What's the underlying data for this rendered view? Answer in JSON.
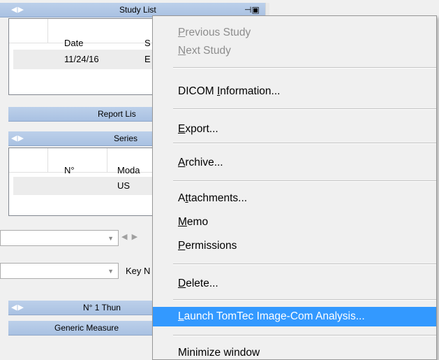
{
  "study_list": {
    "title": "Study List",
    "columns": [
      "Date",
      "S"
    ],
    "rows": [
      [
        "11/24/16",
        "E"
      ]
    ]
  },
  "report_list": {
    "title": "Report Lis"
  },
  "series": {
    "title": "Series",
    "columns": [
      "N°",
      "Moda"
    ],
    "rows": [
      [
        "",
        "US"
      ]
    ]
  },
  "key_label": "Key N",
  "thumbnails": {
    "title": "N° 1 Thun"
  },
  "generic_measure": {
    "title": "Generic Measure"
  },
  "context_menu": {
    "items": [
      {
        "pre": "",
        "u": "P",
        "post": "revious Study",
        "disabled": true
      },
      {
        "pre": "",
        "u": "N",
        "post": "ext Study",
        "disabled": true
      },
      {
        "pre": "DICOM ",
        "u": "I",
        "post": "nformation...",
        "disabled": false
      },
      {
        "pre": "",
        "u": "E",
        "post": "xport...",
        "disabled": false
      },
      {
        "pre": "",
        "u": "A",
        "post": "rchive...",
        "disabled": false
      },
      {
        "pre": "A",
        "u": "t",
        "post": "tachments...",
        "disabled": false
      },
      {
        "pre": "",
        "u": "M",
        "post": "emo",
        "disabled": false
      },
      {
        "pre": "",
        "u": "P",
        "post": "ermissions",
        "disabled": false
      },
      {
        "pre": "",
        "u": "D",
        "post": "elete...",
        "disabled": false
      },
      {
        "pre": "",
        "u": "L",
        "post": "aunch TomTec Image-Com Analysis...",
        "disabled": false
      },
      {
        "pre": "Minimize window",
        "u": "",
        "post": "",
        "disabled": false
      }
    ]
  }
}
